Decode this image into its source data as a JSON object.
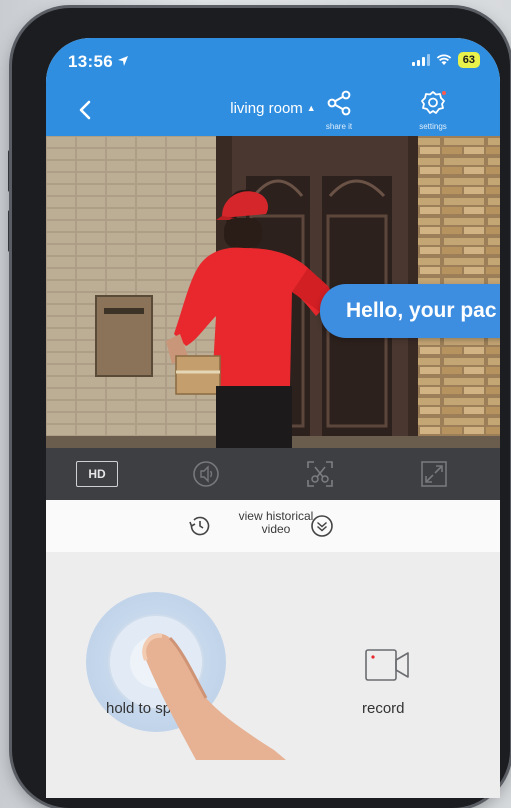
{
  "status_bar": {
    "time": "13:56",
    "battery": "63"
  },
  "header": {
    "title": "living room",
    "share_label": "share it",
    "settings_label": "settings"
  },
  "video": {
    "speech_bubble": "Hello, your pac"
  },
  "toolbar": {
    "hd_label": "HD"
  },
  "history": {
    "label_line1": "view historical",
    "label_line2": "video"
  },
  "controls": {
    "talk_label": "hold to sp",
    "record_label": "record"
  },
  "colors": {
    "header_blue": "#2f8ee0",
    "bubble_blue": "#3d8de0",
    "toolbar_dark": "#3e3f43",
    "battery_yellow": "#e8f24a",
    "shirt_red": "#e8282d"
  }
}
